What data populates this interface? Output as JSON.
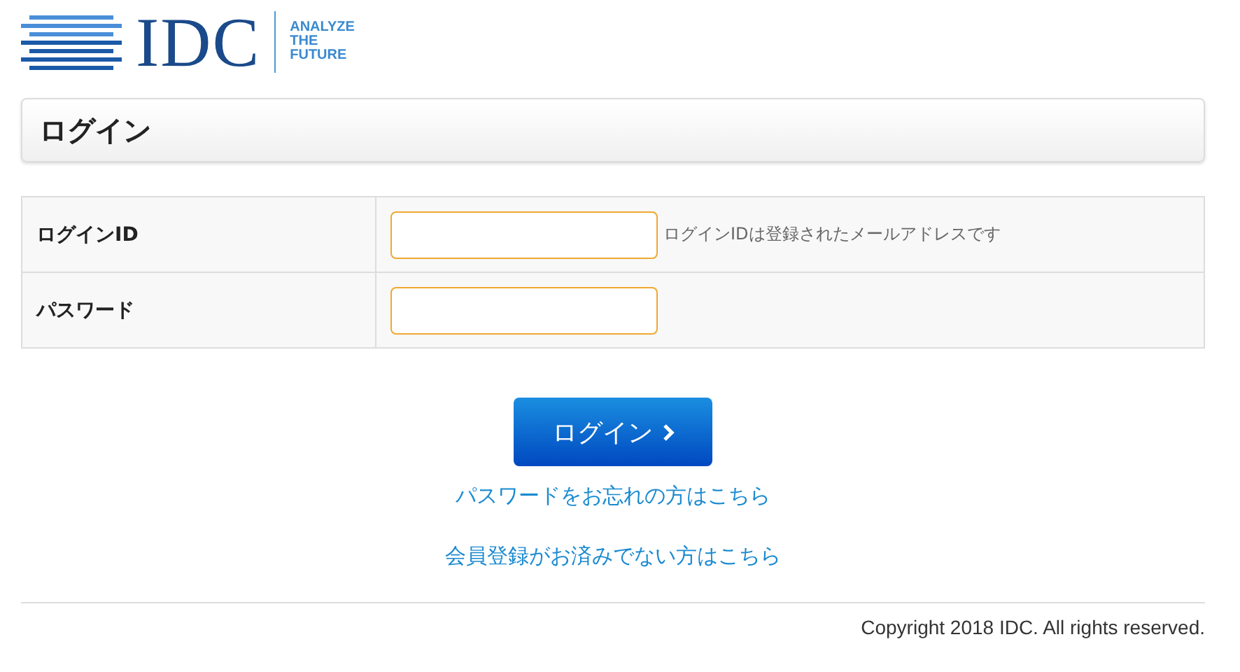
{
  "logo": {
    "wordmark": "IDC",
    "tagline": [
      "ANALYZE",
      "THE",
      "FUTURE"
    ]
  },
  "heading": "ログイン",
  "form": {
    "rows": [
      {
        "label": "ログインID",
        "hint": "ログインIDは登録されたメールアドレスです"
      },
      {
        "label": "パスワード"
      }
    ]
  },
  "submit_button": "ログイン",
  "links": [
    "パスワードをお忘れの方はこちら",
    "会員登録がお済みでない方はこちら"
  ],
  "footer": "Copyright 2018 IDC. All rights reserved."
}
